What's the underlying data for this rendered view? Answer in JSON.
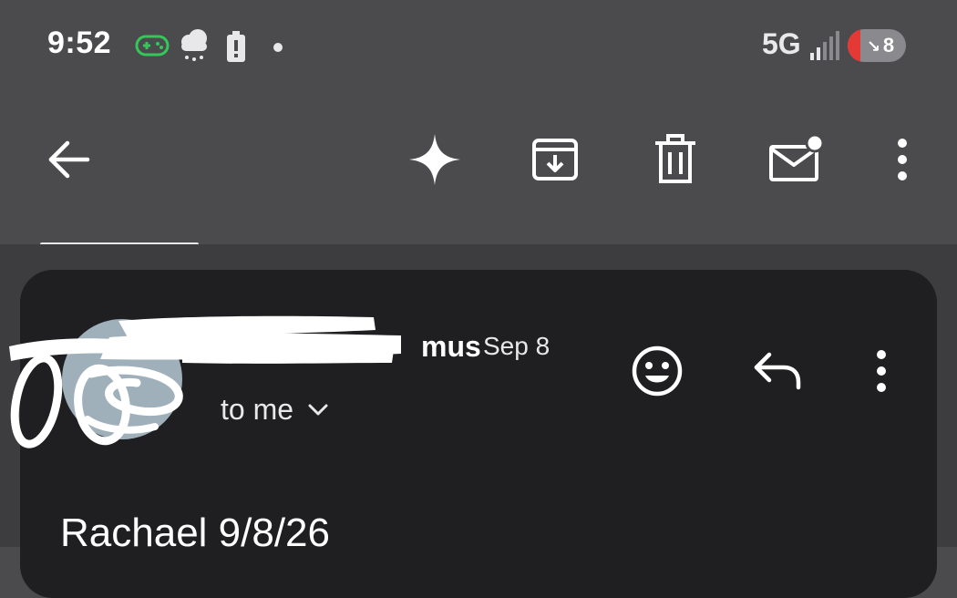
{
  "status_bar": {
    "time": "9:52",
    "network": "5G",
    "battery_level": "8",
    "icons": [
      "gamepad-icon",
      "cloudy-rain-icon",
      "battery-alert-icon",
      "notification-dot-icon",
      "signal-bars-icon",
      "battery-icon"
    ]
  },
  "toolbar": {
    "icons": [
      "back-arrow-icon",
      "sparkle-icon",
      "archive-icon",
      "trash-icon",
      "mark-unread-icon",
      "more-vert-icon"
    ]
  },
  "message": {
    "sender_visible_tail": "mus",
    "date": "Sep 8",
    "recipient": "to me",
    "subject": "Rachael 9/8/26",
    "icons": [
      "avatar",
      "emoji-reaction-icon",
      "reply-icon",
      "more-vert-icon",
      "chevron-down-icon"
    ]
  },
  "colors": {
    "status_toolbar_bg": "#4b4b4e",
    "content_bg": "#3d3d40",
    "card_bg": "#1f1f21",
    "avatar_bg": "#9fb0ba",
    "gamepad_green": "#34c759",
    "battery_red": "#e53935"
  }
}
